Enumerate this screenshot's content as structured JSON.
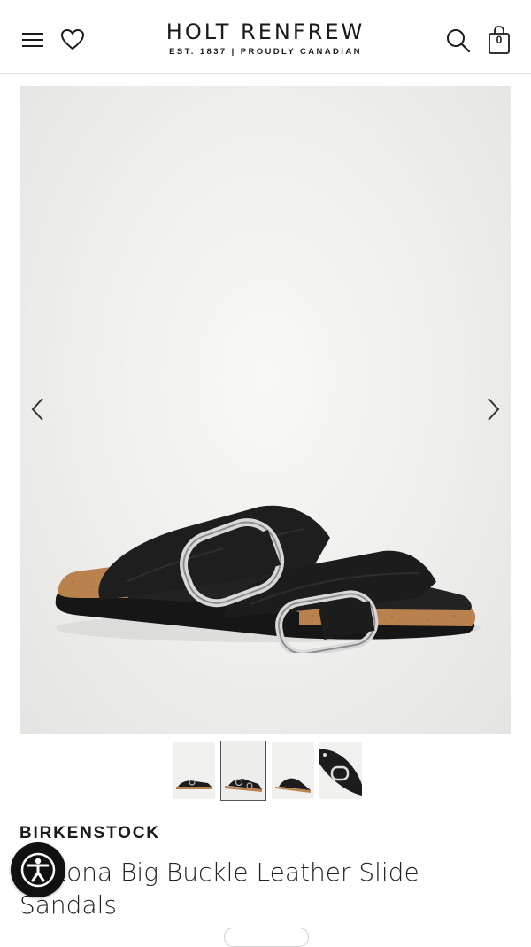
{
  "header": {
    "logo_title": "HOLT RENFREW",
    "logo_subtitle": "EST. 1837 | PROUDLY CANADIAN",
    "bag_count": "0",
    "icons": [
      "menu-icon",
      "heart-icon",
      "search-icon",
      "bag-icon"
    ]
  },
  "gallery": {
    "image_count": 4,
    "active_index": 1,
    "icons": [
      "chevron-left-icon",
      "chevron-right-icon"
    ]
  },
  "product": {
    "brand": "BIRKENSTOCK",
    "name": "Arizona Big Buckle Leather Slide Sandals"
  },
  "colors": {
    "text": "#1a1a1a",
    "leather": "#1c1c1c",
    "cork": "#b8814e",
    "buckle": "#d8d8d8"
  }
}
